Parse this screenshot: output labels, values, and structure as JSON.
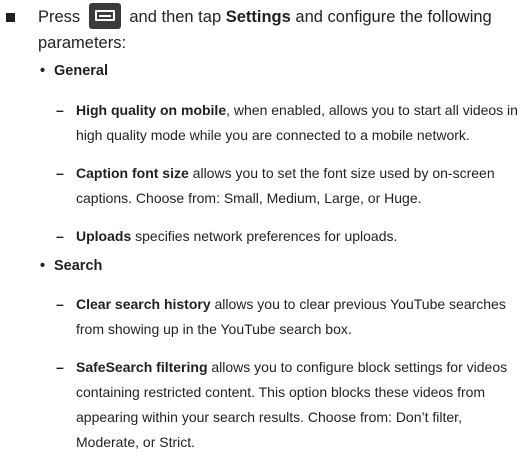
{
  "lead": {
    "before_icon": "Press",
    "after_icon": "and then tap",
    "settings_word": "Settings",
    "rest": "and configure the following parameters:"
  },
  "icon": {
    "menu": "menu-icon",
    "bullet": "square-bullet"
  },
  "groups": [
    {
      "heading": "General",
      "items": [
        {
          "term": "High quality on mobile",
          "text": ", when enabled, allows you to start all videos in high quality mode while you are connected to a mobile network."
        },
        {
          "term": "Caption font size",
          "text": " allows you to set the font size used by on-screen captions. Choose from: Small, Medium, Large, or Huge."
        },
        {
          "term": "Uploads",
          "text": " specifies network preferences for uploads."
        }
      ]
    },
    {
      "heading": "Search",
      "items": [
        {
          "term": "Clear search history",
          "text": " allows you to clear previous YouTube searches from showing up in the YouTube search box."
        },
        {
          "term": "SafeSearch filtering",
          "text": " allows you to configure block settings for videos containing restricted content. This option blocks these videos from appearing within your search results. Choose from: Don’t filter, Moderate, or Strict."
        }
      ]
    }
  ]
}
